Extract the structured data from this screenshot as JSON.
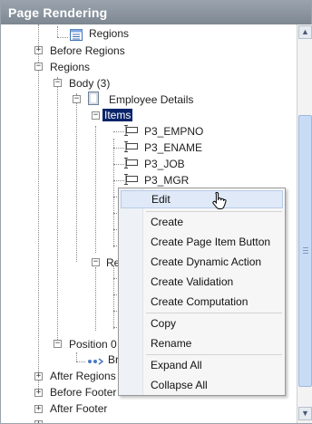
{
  "panel": {
    "title": "Page Rendering"
  },
  "tree": {
    "regions_top": "Regions",
    "before_regions": "Before Regions",
    "regions": "Regions",
    "body": "Body (3)",
    "employee_details": "Employee Details",
    "items": "Items",
    "item_1": "P3_EMPNO",
    "item_2": "P3_ENAME",
    "item_3": "P3_JOB",
    "item_4": "P3_MGR",
    "re_truncated": "Re",
    "position_truncated": "Position 0",
    "br_truncated": "Br",
    "after_regions": "After Regions",
    "before_footer": "Before Footer",
    "after_footer": "After Footer"
  },
  "context_menu": {
    "items": [
      "Edit",
      "Create",
      "Create Page Item Button",
      "Create Dynamic Action",
      "Create Validation",
      "Create Computation",
      "Copy",
      "Rename",
      "Expand All",
      "Collapse All"
    ]
  },
  "colors": {
    "title_bar": "#8a939e",
    "selection": "#0a246a",
    "menu_hover": "#dfe9f7",
    "scroll_thumb": "#c9dcf6"
  }
}
